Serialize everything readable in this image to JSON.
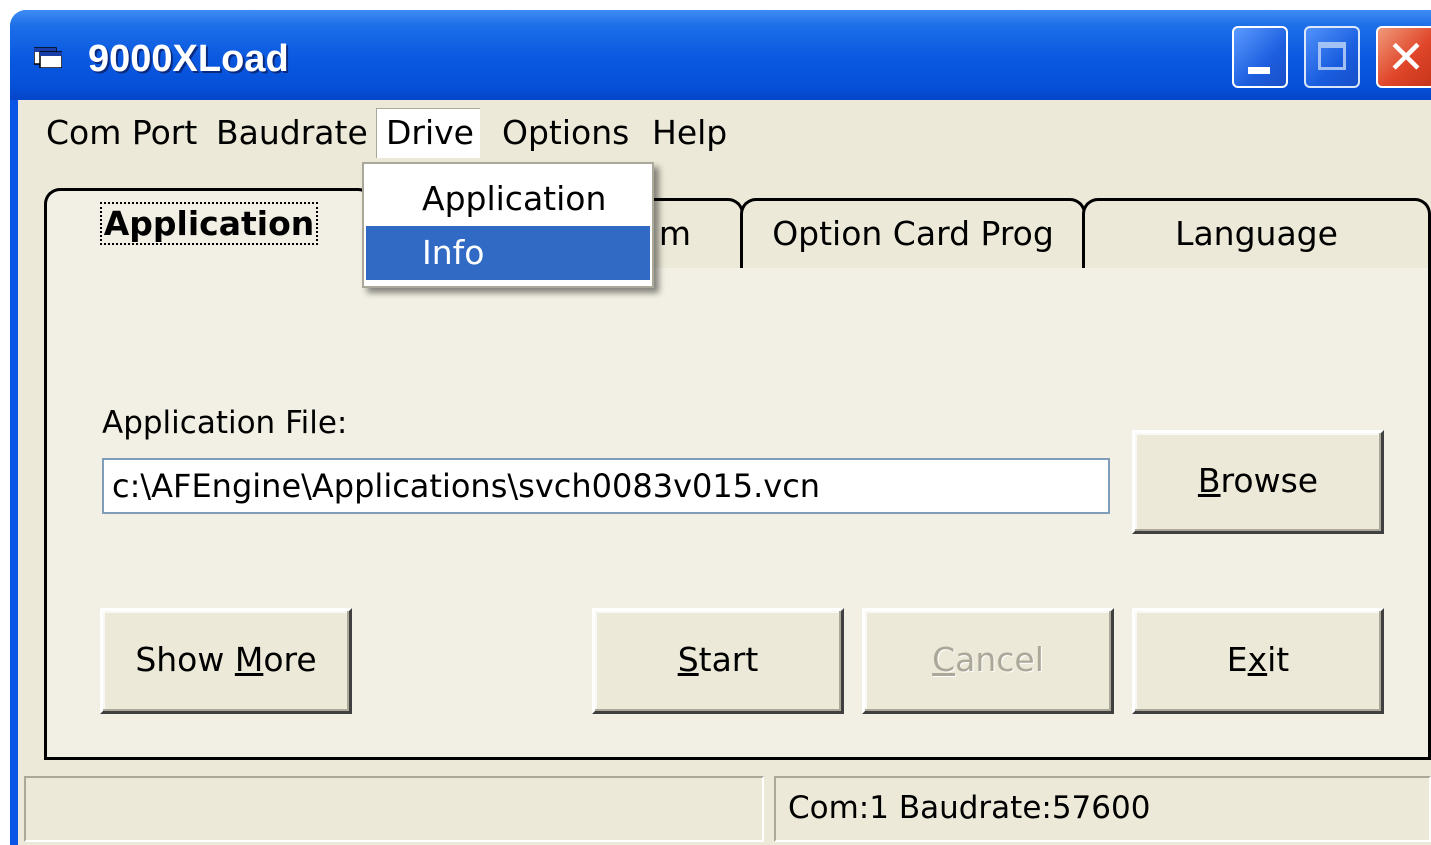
{
  "window": {
    "title": "9000XLoad",
    "icon": "app-window-icon",
    "controls": [
      "minimize-icon",
      "maximize-icon",
      "close-icon"
    ]
  },
  "menubar": {
    "items": [
      {
        "label": "Com Port"
      },
      {
        "label": "Baudrate"
      },
      {
        "label": "Drive"
      },
      {
        "label": "Options"
      },
      {
        "label": "Help"
      }
    ],
    "open_menu": "Drive"
  },
  "dropdown": {
    "items": [
      {
        "label": "Application",
        "selected": false
      },
      {
        "label": "Info",
        "selected": true
      }
    ],
    "highlight_color": "#316ac5"
  },
  "tabs": [
    {
      "label": "Application",
      "active": true
    },
    {
      "label": "m",
      "active": false
    },
    {
      "label": "Option Card Prog",
      "active": false
    },
    {
      "label": "Language",
      "active": false
    }
  ],
  "application_panel": {
    "file_label": "Application File:",
    "file_value": "c:\\AFEngine\\Applications\\svch0083v015.vcn",
    "buttons": {
      "browse": {
        "label": "Browse",
        "mnemonic": "B"
      },
      "show_more": {
        "label": "Show More",
        "mnemonic": "M"
      },
      "start": {
        "label": "Start",
        "mnemonic": "S"
      },
      "cancel": {
        "label": "Cancel",
        "mnemonic": "C",
        "disabled": true
      },
      "exit": {
        "label": "Exit",
        "mnemonic": "x"
      }
    }
  },
  "statusbar": {
    "left": "",
    "right": "Com:1  Baudrate:57600"
  },
  "colors": {
    "titlebar": "#0a58e0",
    "face": "#ece9d8",
    "close_button": "#e0462a"
  }
}
